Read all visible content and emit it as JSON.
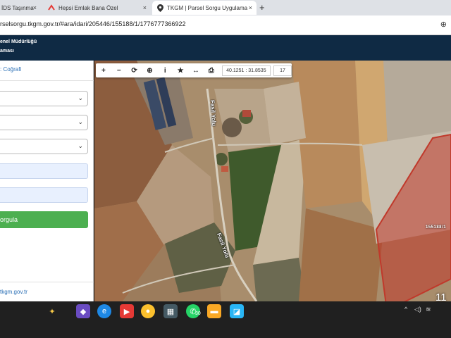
{
  "tabs": [
    {
      "label": "İDS Taşınma",
      "icon": "document-icon"
    },
    {
      "label": "Hepsi Emlak Bana Özel",
      "icon": "hepsiemlak-logo-icon"
    },
    {
      "label": "TKGM | Parsel Sorgu Uygulama",
      "icon": "location-pin-icon"
    }
  ],
  "tab_close": "×",
  "new_tab": "+",
  "address": {
    "url": "rselsorgu.tkgm.gov.tr/#ara/idari/205446/155188/1/1776777366922",
    "zoom_icon": "⊕"
  },
  "header": {
    "line1": "enel Müdürlüğü",
    "line2": "aması"
  },
  "panel": {
    "tab_label": ": Coğrafi",
    "button_label": "orgula",
    "footer_link": "tkgm.gov.tr",
    "chevron": "⌄"
  },
  "map": {
    "tools": [
      "+",
      "−",
      "⟳",
      "⊕",
      "i",
      "★",
      "↔",
      "⎙"
    ],
    "tool_names": [
      "zoom-in-icon",
      "zoom-out-icon",
      "refresh-icon",
      "locate-icon",
      "info-icon",
      "favorite-icon",
      "measure-icon",
      "print-icon"
    ],
    "coordinates": "40.1251 : 31.8535",
    "zoom_level": "17",
    "parcel_label": "155188/1",
    "road_label_1": "Fasil Yolu",
    "road_label_2": "Fasil Yolu",
    "parcel_color": "#c0392b"
  },
  "taskbar": {
    "whatsapp_badge": "30",
    "tray_chevron": "^",
    "clock_partial": "11"
  }
}
